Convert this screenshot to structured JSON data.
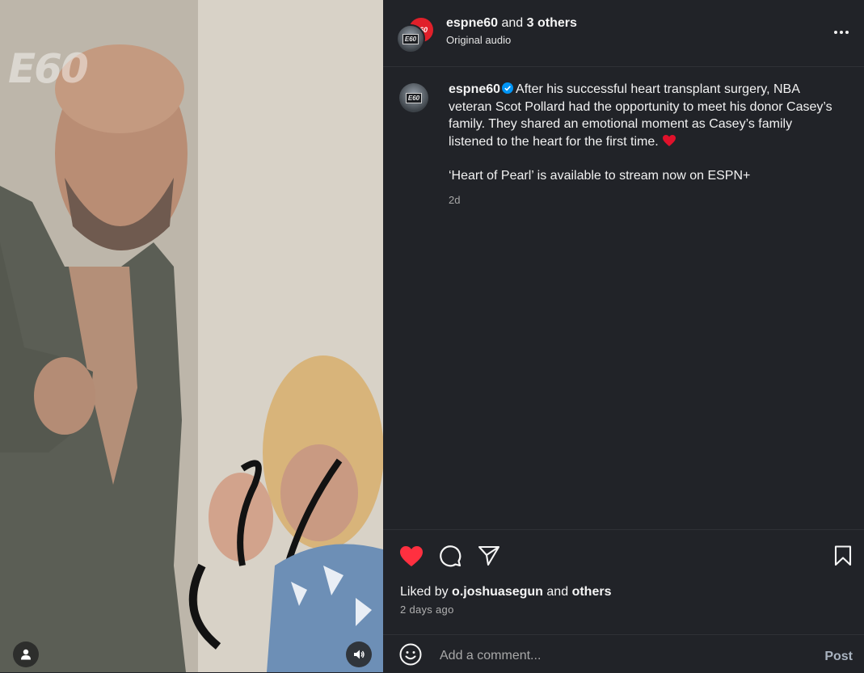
{
  "media": {
    "watermark": "E60",
    "user_tag_icon": "person-icon",
    "audio_icon": "speaker-icon"
  },
  "header": {
    "username": "espne60",
    "joiner": "and",
    "others": "3 others",
    "audio": "Original audio",
    "avatar_logo": "E60",
    "badge_logo": "E60"
  },
  "caption": {
    "username": "espne60",
    "text": "After his successful heart transplant surgery, NBA veteran Scot Pollard had the opportunity to meet his donor Casey’s family. They shared an emotional moment as Casey’s family listened to the heart for the first time.",
    "promo": "‘Heart of Pearl’ is available to stream now on ESPN+",
    "time": "2d",
    "avatar_logo": "E60"
  },
  "actions": {
    "liked_prefix": "Liked by",
    "liked_user": "o.joshuasegun",
    "liked_joiner": "and",
    "liked_others": "others",
    "date": "2 days ago"
  },
  "comment": {
    "placeholder": "Add a comment...",
    "post_label": "Post"
  },
  "colors": {
    "background": "#212328",
    "like_red": "#ff3040",
    "verified_blue": "#0095f6",
    "post_disabled": "#a9b3c0"
  }
}
